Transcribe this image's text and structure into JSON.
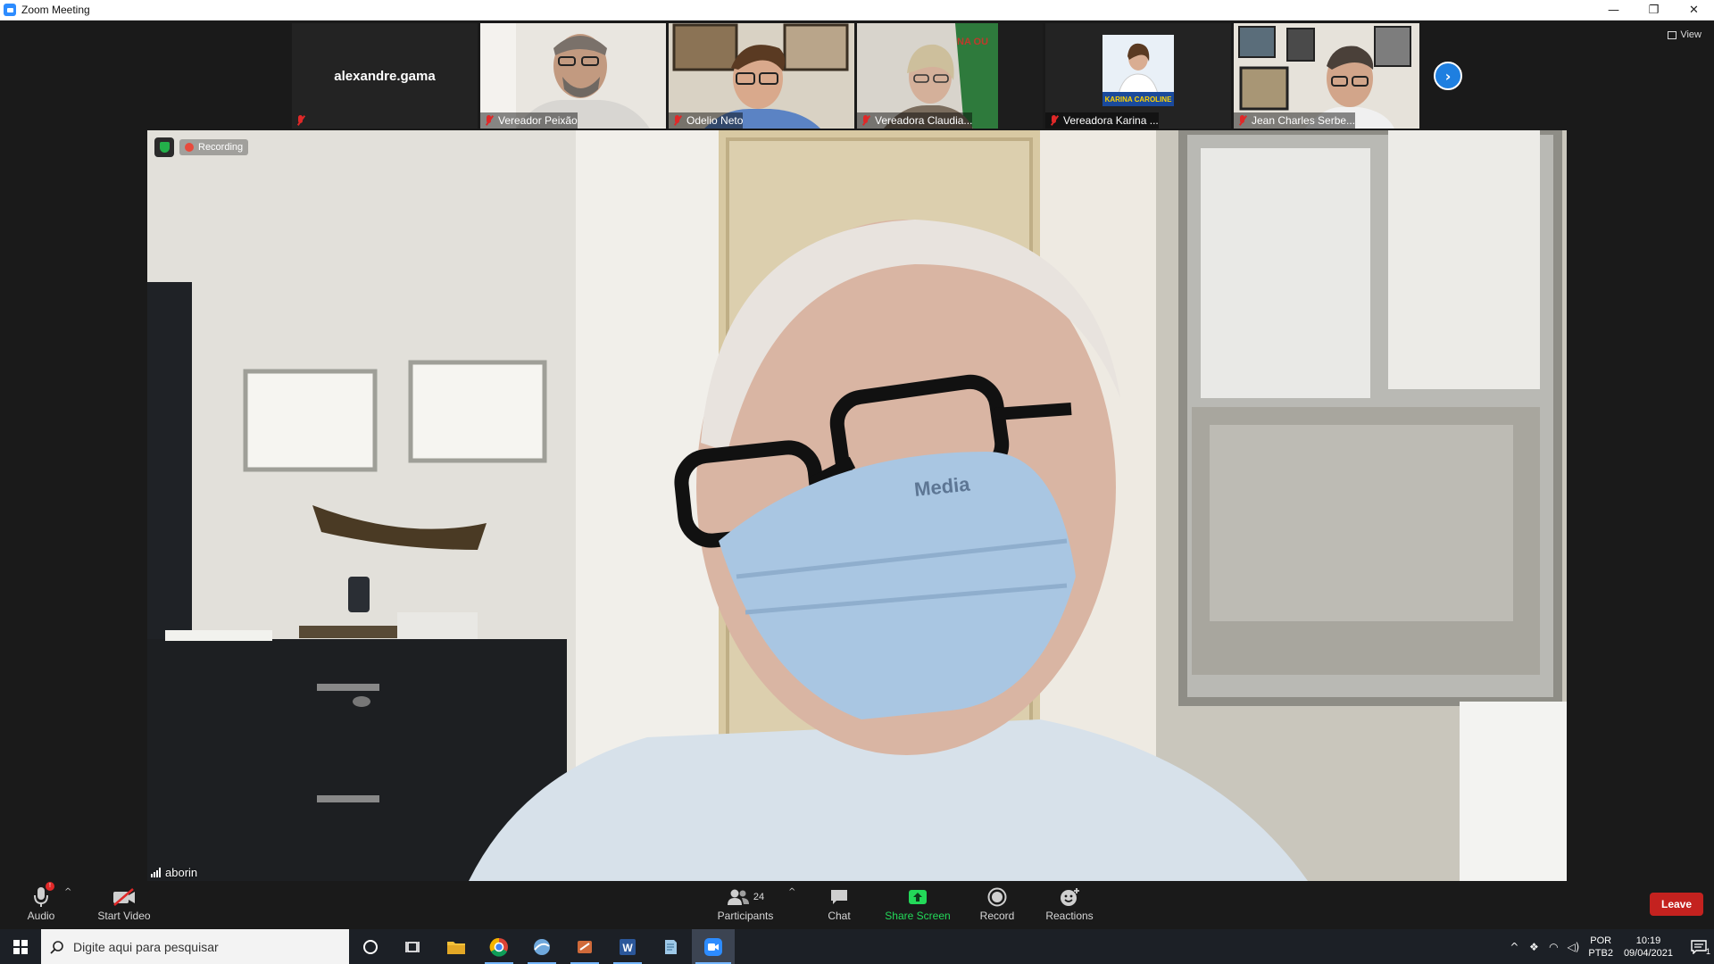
{
  "window": {
    "title": "Zoom Meeting",
    "controls": {
      "minimize": "—",
      "restore": "❐",
      "close": "✕"
    }
  },
  "gallery": {
    "participants": [
      {
        "name": "alexandre.gama",
        "video": false
      },
      {
        "name": "Vereador Peixão",
        "video": true
      },
      {
        "name": "Odelio Neto",
        "video": true
      },
      {
        "name": "Vereadora Claudia...",
        "video": true
      },
      {
        "name": "Vereadora Karina ...",
        "video": true,
        "poster_text": "KARINA CAROLINE"
      },
      {
        "name": "Jean Charles Serbe...",
        "video": true
      }
    ],
    "next_page_icon": "chevron-right-icon",
    "view_label": "View"
  },
  "main": {
    "recording_label": "Recording",
    "speaker_name": "aborin",
    "mask_text": "Media"
  },
  "toolbar": {
    "audio_label": "Audio",
    "start_video_label": "Start Video",
    "participants_label": "Participants",
    "participants_count": "24",
    "chat_label": "Chat",
    "share_screen_label": "Share Screen",
    "record_label": "Record",
    "reactions_label": "Reactions",
    "leave_label": "Leave",
    "accent_green": "#23d959",
    "leave_color": "#c4221f"
  },
  "taskbar": {
    "search_placeholder": "Digite aqui para pesquisar",
    "lang_primary": "POR",
    "lang_secondary": "PTB2",
    "time": "10:19",
    "date": "09/04/2021",
    "notification_count": "1"
  }
}
